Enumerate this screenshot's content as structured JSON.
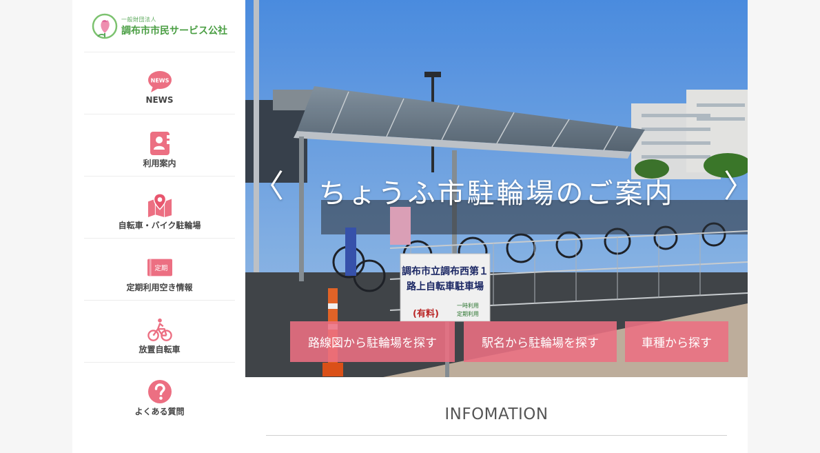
{
  "logo": {
    "org_type": "一般財団法人",
    "org_name": "調布市市民サービス公社",
    "icon": "flower-logo-icon"
  },
  "sidebar": {
    "items": [
      {
        "label": "NEWS",
        "icon": "news-bubble-icon"
      },
      {
        "label": "利用案内",
        "icon": "guide-book-icon"
      },
      {
        "label": "自転車・バイク駐輪場",
        "icon": "map-pin-icon"
      },
      {
        "label": "定期利用空き情報",
        "icon": "teiki-badge-icon",
        "icon_text": "定期"
      },
      {
        "label": "放置自転車",
        "icon": "bicycle-icon"
      },
      {
        "label": "よくある質問",
        "icon": "question-icon"
      }
    ]
  },
  "hero": {
    "title": "ちょうふ市駐輪場のご案内",
    "prev_arrow": "〈",
    "next_arrow": "〉",
    "sign_line1": "調布市立調布西第１",
    "sign_line2": "路上自転車駐車場",
    "sign_line3": "(有料)",
    "sign_line4": "一時利用",
    "sign_line5": "定期利用",
    "buttons": [
      {
        "label": "路線図から駐輪場を探す"
      },
      {
        "label": "駅名から駐輪場を探す"
      },
      {
        "label": "車種から探す"
      }
    ]
  },
  "info": {
    "title": "INFOMATION"
  },
  "colors": {
    "accent_pink": "#ec6f82",
    "logo_green": "#4a9e43",
    "sky": "#5da0ee"
  }
}
